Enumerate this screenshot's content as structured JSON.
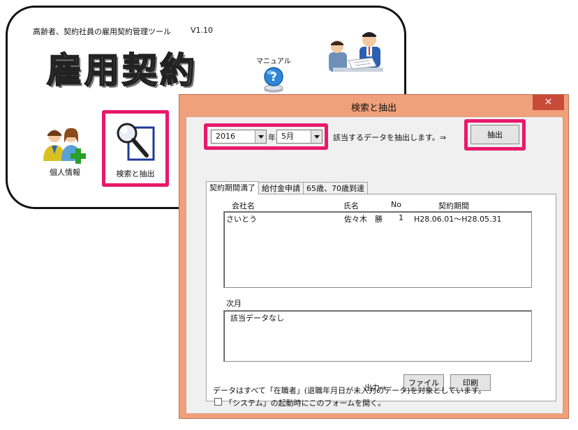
{
  "app": {
    "title": "高齢者、契約社員の雇用契約管理ツール",
    "version": "V1.10",
    "logo": "雇用契約",
    "manual_label": "マニュアル",
    "tiles": {
      "personal_label": "個人情報",
      "search_label": "検索と抽出"
    }
  },
  "dialog": {
    "title": "検索と抽出",
    "close_glyph": "×",
    "year_value": "2016",
    "year_suffix": "年",
    "month_value": "5月",
    "instruction": "該当するデータを抽出します。⇒",
    "extract_button": "抽出",
    "tabs": [
      "契約期間満了",
      "給付金申請",
      "65歳、70歳到達"
    ],
    "list": {
      "headers": {
        "company": "会社名",
        "name": "氏名",
        "no": "No",
        "period": "契約期間"
      },
      "rows": [
        {
          "company": "さいとう",
          "name": "佐々木　勝",
          "no": "1",
          "period": "H28.06.01～H28.05.31"
        }
      ]
    },
    "next_month": {
      "label": "次月",
      "text": "該当データなし"
    },
    "output_label": "出力⇒",
    "file_button": "ファイル",
    "print_button": "印刷",
    "note": "データはすべて「在職者」(退職年月日が未入力のデータ)を対象としています。",
    "startup_checkbox_label": "「システム」の起動時にこのフォームを開く。",
    "startup_checked": false
  },
  "colors": {
    "highlight": "#e8196b",
    "dialog_frame": "#f0a07a",
    "close_button": "#c84b3a"
  }
}
